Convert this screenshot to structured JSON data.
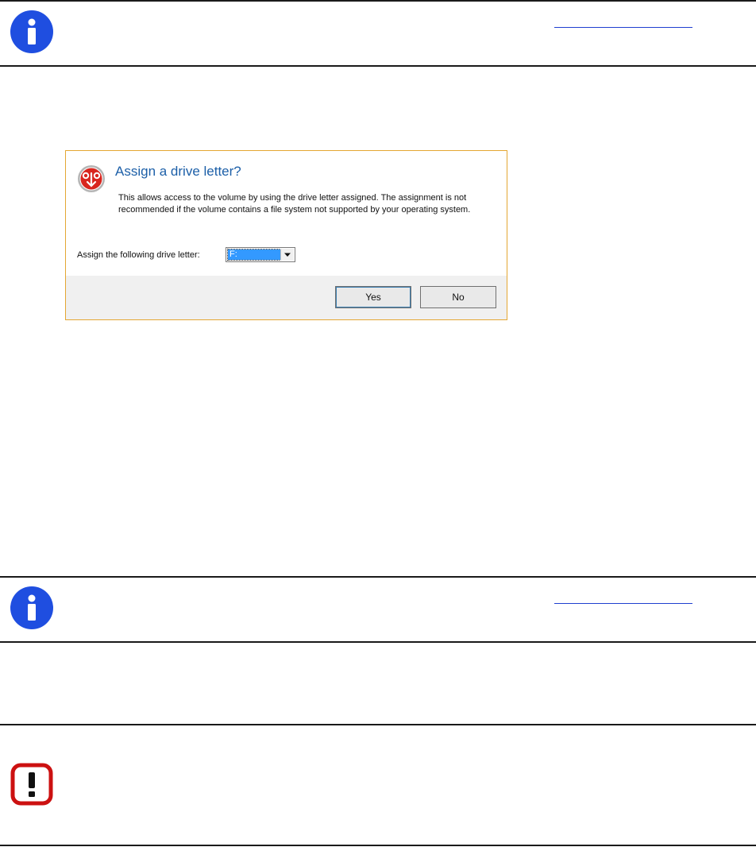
{
  "note_top": {
    "icon": "info-icon",
    "icon_color": "#1f4ee0"
  },
  "note_middle": {
    "icon": "info-icon",
    "icon_color": "#1f4ee0"
  },
  "warning": {
    "icon": "exclamation-icon",
    "icon_color": "#cc1111"
  },
  "dialog": {
    "title": "Assign a drive letter?",
    "description": "This allows access to the volume by using the drive letter assigned. The assignment is not recommended if the volume contains a file system not supported by your operating system.",
    "field_label": "Assign the following drive letter:",
    "selected_letter": "F:",
    "yes_label": "Yes",
    "no_label": "No",
    "border_color": "#e4a733",
    "title_color": "#1c5fa8"
  }
}
